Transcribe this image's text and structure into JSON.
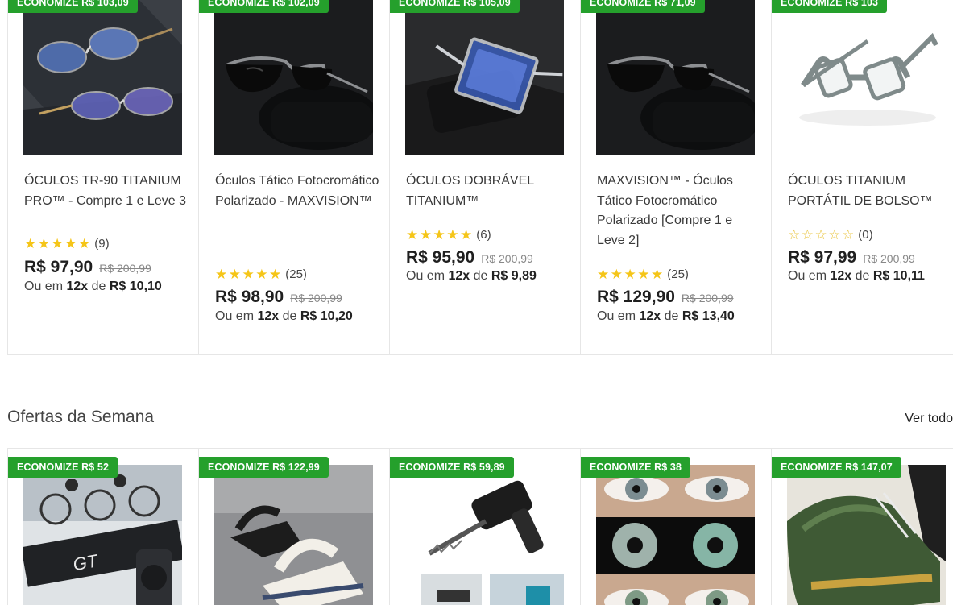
{
  "top_products": [
    {
      "badge": "ECONOMIZE R$ 103,09",
      "image_icon": "eyeglasses-pair-photo",
      "title": "ÓCULOS TR-90 TITANIUM PRO™ - Compre 1 e Leve 3",
      "stars": 5,
      "reviews": "(9)",
      "price": "R$ 97,90",
      "old_price": "R$ 200,99",
      "inst_prefix": "Ou em",
      "inst_count": "12x",
      "inst_de": "de",
      "inst_value": "R$ 10,10"
    },
    {
      "badge": "ECONOMIZE R$ 102,09",
      "image_icon": "sunglasses-photo",
      "title": "Óculos Tático Fotocromático Polarizado - MAXVISION™",
      "stars": 5,
      "reviews": "(25)",
      "price": "R$ 98,90",
      "old_price": "R$ 200,99",
      "inst_prefix": "Ou em",
      "inst_count": "12x",
      "inst_de": "de",
      "inst_value": "R$ 10,20"
    },
    {
      "badge": "ECONOMIZE R$ 105,09",
      "image_icon": "folding-glasses-photo",
      "title": "ÓCULOS DOBRÁVEL TITANIUM™",
      "stars": 5,
      "reviews": "(6)",
      "price": "R$ 95,90",
      "old_price": "R$ 200,99",
      "inst_prefix": "Ou em",
      "inst_count": "12x",
      "inst_de": "de",
      "inst_value": "R$ 9,89"
    },
    {
      "badge": "ECONOMIZE R$ 71,09",
      "image_icon": "sunglasses-photo",
      "title": "MAXVISION™ - Óculos Tático Fotocromático Polarizado [Compre 1 e Leve 2]",
      "stars": 5,
      "reviews": "(25)",
      "price": "R$ 129,90",
      "old_price": "R$ 200,99",
      "inst_prefix": "Ou em",
      "inst_count": "12x",
      "inst_de": "de",
      "inst_value": "R$ 13,40"
    },
    {
      "badge": "ECONOMIZE R$ 103",
      "image_icon": "pocket-glasses-photo",
      "title": "ÓCULOS TITANIUM PORTÁTIL DE BOLSO™",
      "stars": 0,
      "reviews": "(0)",
      "price": "R$ 97,99",
      "old_price": "R$ 200,99",
      "inst_prefix": "Ou em",
      "inst_count": "12x",
      "inst_de": "de",
      "inst_value": "R$ 10,11"
    }
  ],
  "section": {
    "title": "Ofertas da Semana",
    "see_all": "Ver todo"
  },
  "offers": [
    {
      "badge": "ECONOMIZE R$ 52",
      "image_icon": "bike-horn-photo"
    },
    {
      "badge": "ECONOMIZE R$ 122,99",
      "image_icon": "sandals-photo"
    },
    {
      "badge": "ECONOMIZE R$ 59,89",
      "image_icon": "reciprocating-saw-adapter-photo"
    },
    {
      "badge": "ECONOMIZE R$ 38",
      "image_icon": "colored-contact-lenses-photo"
    },
    {
      "badge": "ECONOMIZE R$ 147,07",
      "image_icon": "safety-sneaker-photo"
    }
  ],
  "colors": {
    "badge_green": "#25a02c",
    "star_gold": "#f5c518"
  }
}
